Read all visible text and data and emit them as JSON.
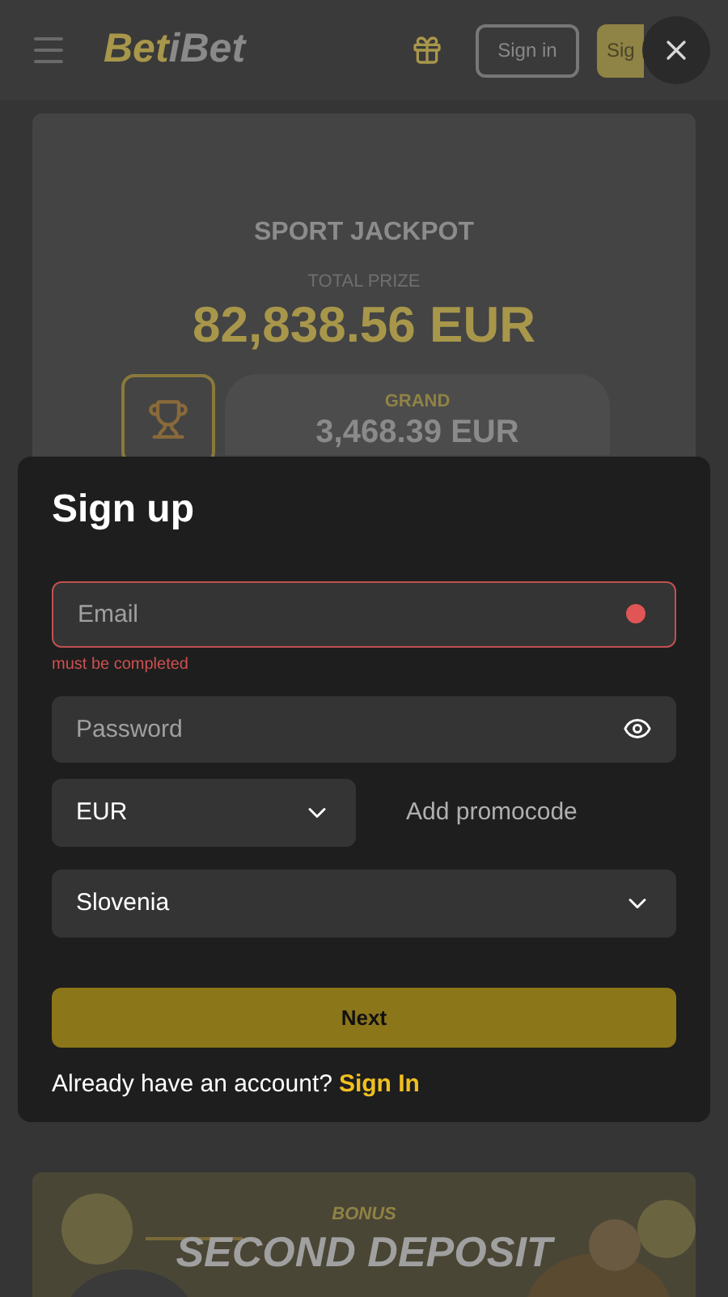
{
  "header": {
    "logo": [
      {
        "text": "Bet",
        "kind": "accent"
      },
      {
        "text": "iBet",
        "kind": "plain"
      }
    ],
    "sign_in": "Sign in",
    "sign_up": "Sig"
  },
  "jackpot": {
    "title": "SPORT JACKPOT",
    "subtitle": "TOTAL PRIZE",
    "amount": "82,838.56 EUR",
    "tier": "GRAND",
    "tier_amount": "3,468.39 EUR"
  },
  "modal": {
    "title": "Sign up",
    "fields": [
      {
        "kind": "text",
        "placeholder": "Email",
        "error": "must be completed"
      },
      {
        "kind": "password",
        "placeholder": "Password"
      }
    ],
    "currency": "EUR",
    "promocode": "Add promocode",
    "country": "Slovenia",
    "submit": "Next",
    "footer": "Already have an account?",
    "footer_link": "Sign In"
  },
  "banner": {
    "kind": "picture",
    "label": "BONUS",
    "title": "SECOND DEPOSIT"
  }
}
